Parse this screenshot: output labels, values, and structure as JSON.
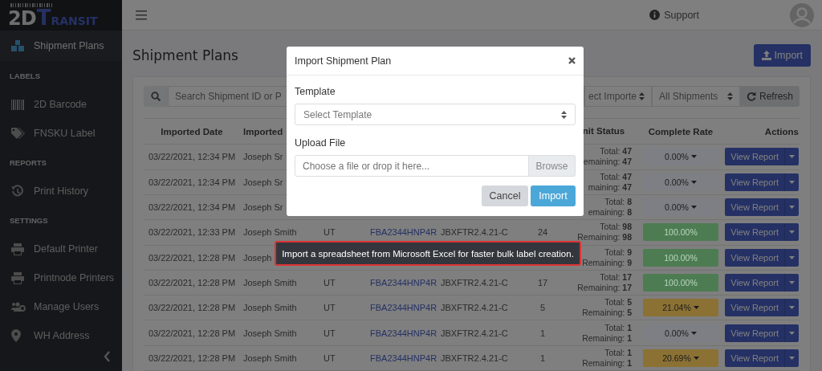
{
  "logo": {
    "text_1": "2D",
    "text_2": "TRANSIT"
  },
  "sidebar": {
    "sections": [
      {
        "items": [
          {
            "label": "Shipment Plans",
            "selected": true
          }
        ]
      },
      {
        "title": "LABELS",
        "items": [
          {
            "label": "2D Barcode",
            "selected": false
          },
          {
            "label": "FNSKU Label",
            "selected": false
          }
        ]
      },
      {
        "title": "REPORTS",
        "items": [
          {
            "label": "Print History",
            "selected": false
          }
        ]
      },
      {
        "title": "SETTINGS",
        "items": [
          {
            "label": "Default Printer",
            "selected": false
          },
          {
            "label": "Printnode Printers",
            "selected": false
          },
          {
            "label": "Manage Users",
            "selected": false
          },
          {
            "label": "WH Address",
            "selected": false
          }
        ]
      }
    ]
  },
  "topbar": {
    "support": "Support"
  },
  "page": {
    "title": "Shipment Plans",
    "import_button": "Import"
  },
  "filters": {
    "search_placeholder": "Search Shipment ID or P",
    "importer": "ect Importe",
    "shipments": "All Shipments",
    "refresh": "Refresh"
  },
  "table": {
    "columns": [
      "Imported Date",
      "Imported",
      "nit Status",
      "Complete Rate",
      "Actions"
    ],
    "rows": [
      {
        "date": "03/22/2021, 12:34 PM",
        "user": "Joseph Sr",
        "units": [
          "Total: **47**",
          "emaining: **47**"
        ],
        "rate": {
          "text": "0.00%",
          "color": "#7d7f84",
          "dropdown": true
        },
        "action": "View Report"
      },
      {
        "date": "03/22/2021, 12:34 PM",
        "user": "Joseph Sr",
        "units": [
          "Total: **47**",
          "maining: **47**"
        ],
        "rate": {
          "text": "0.00%",
          "color": "#7d7f84",
          "dropdown": true
        },
        "action": "View Report"
      },
      {
        "date": "03/22/2021, 12:34 PM",
        "user": "Joseph Sr",
        "units": [
          "Total: **8**",
          "emaining: **8**"
        ],
        "rate": {
          "text": "0.00%",
          "color": "#7d7f84",
          "dropdown": true
        },
        "action": "View Report"
      },
      {
        "date": "03/22/2021, 12:33 PM",
        "user": "Joseph Smith",
        "state": "UT",
        "shipment_id": "FBA2344HNP4R",
        "reference": "JBXFTR2.4.21-C",
        "count": "24",
        "units": [
          "Total: **98**",
          "Remaining: **98**"
        ],
        "rate": {
          "text": "100.00%",
          "color": "#4d7c53",
          "dropdown": false
        },
        "action": "View Report"
      },
      {
        "date": "03/22/2021, 12:28 PM",
        "user": "Joseph",
        "units": [
          "Total: **9**",
          "Remaining: **9**"
        ],
        "rate": {
          "text": "100.00%",
          "color": "#4d7c53",
          "dropdown": false
        },
        "action": "View Report"
      },
      {
        "date": "03/22/2021, 12:28 PM",
        "user": "Joseph Smith",
        "state": "UT",
        "shipment_id": "FBA2344HNP4R",
        "reference": "JBXFTR2.4.21-C",
        "count": "17",
        "units": [
          "Total: **17**",
          "Remaining: **17**"
        ],
        "rate": {
          "text": "100.00%",
          "color": "#4d7c53",
          "dropdown": false
        },
        "action": "View Report"
      },
      {
        "date": "03/22/2021, 12:28 PM",
        "user": "Joseph Smith",
        "state": "UT",
        "shipment_id": "FBA2344HNP4R",
        "reference": "JBXFTR2.4.21-C",
        "count": "5",
        "units": [
          "Total: **5**",
          "Remaining: **5**"
        ],
        "rate": {
          "text": "21.04%",
          "color": "#8b7134",
          "dropdown": true
        },
        "action": "View Report"
      },
      {
        "date": "03/22/2021, 12:28 PM",
        "user": "Joseph Smith",
        "state": "UT",
        "shipment_id": "FBA2344HNP4R",
        "reference": "JBXFTR2.4.21-C",
        "count": "1",
        "units": [
          "Total: **1**",
          "Remaining: **1**"
        ],
        "rate": {
          "text": "0.00%",
          "color": "#7d7f84",
          "dropdown": true
        },
        "action": "View Report"
      },
      {
        "date": "03/22/2021, 12:28 PM",
        "user": "Joseph Smith",
        "state": "UT",
        "shipment_id": "FBA2344HNP4R",
        "reference": "JBXFTR2.4.21-C",
        "count": "1",
        "units": [
          "Total: **1**",
          "Remaining: **1**"
        ],
        "rate": {
          "text": "20.69%",
          "color": "#8b7134",
          "dropdown": true
        },
        "action": "View Report"
      }
    ]
  },
  "modal": {
    "title": "Import Shipment Plan",
    "template_label": "Template",
    "template_placeholder": "Select Template",
    "upload_label": "Upload File",
    "file_placeholder": "Choose a file or drop it here...",
    "browse": "Browse",
    "cancel": "Cancel",
    "import": "Import"
  },
  "tooltip": "Import a spreadsheet from Microsoft Excel for faster bulk label creation."
}
